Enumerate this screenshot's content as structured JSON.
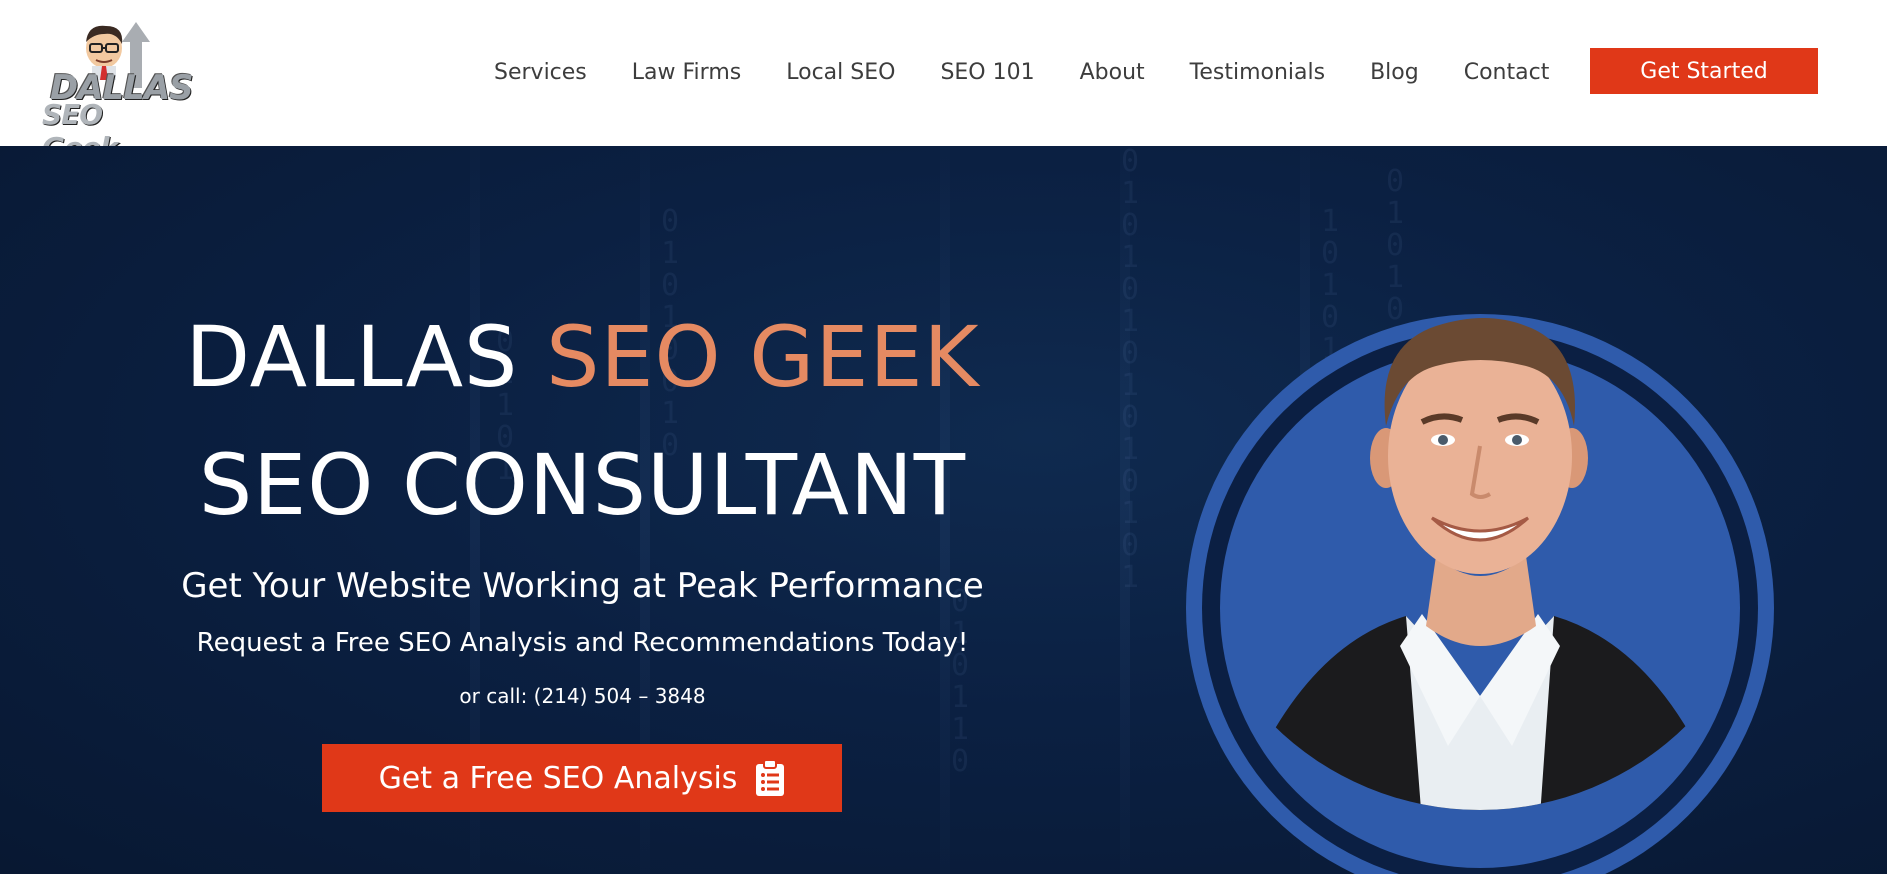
{
  "brand": {
    "logo_line1": "DALLAS",
    "logo_line2": "SEO Geek",
    "accent_color": "#e03818",
    "title_accent_color": "#e58a62",
    "hero_bg": "#0b2042",
    "ring_color": "#2f5bab"
  },
  "nav": {
    "items": [
      {
        "label": "Services"
      },
      {
        "label": "Law Firms"
      },
      {
        "label": "Local SEO"
      },
      {
        "label": "SEO 101"
      },
      {
        "label": "About"
      },
      {
        "label": "Testimonials"
      },
      {
        "label": "Blog"
      },
      {
        "label": "Contact"
      }
    ],
    "cta_label": "Get Started"
  },
  "hero": {
    "title_part1": "DALLAS ",
    "title_part2": "SEO GEEK",
    "title_line2": "SEO CONSULTANT",
    "subtitle": "Get Your Website Working at Peak Performance",
    "subtitle2": "Request a Free SEO Analysis and Recommendations Today!",
    "phone_line": "or call: (214) 504 – 3848",
    "cta_label": "Get a Free SEO Analysis",
    "cta_icon": "clipboard-list-icon",
    "portrait_icon": "consultant-portrait"
  }
}
